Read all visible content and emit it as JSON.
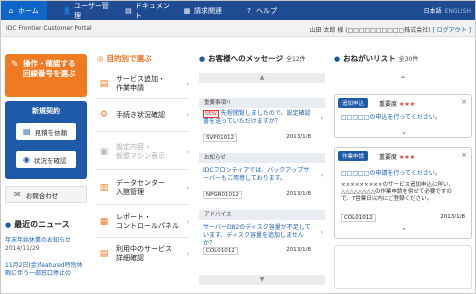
{
  "nav": {
    "tabs": [
      "ホーム",
      "ユーザー管理",
      "ドキュメント",
      "請求関連",
      "ヘルプ"
    ],
    "lang_ja": "日本語",
    "lang_en": "ENGLISH"
  },
  "sub": {
    "portal": "IDC Frontier Customer Portal",
    "user": "山田 太郎 様 (□□□□□□□□□□株式会社)",
    "logout": "[ ログアウト ]"
  },
  "left": {
    "reg_line1": "操作・確認する",
    "reg_line2": "回線番号を選ぶ",
    "new_contract": "新規契約",
    "quote": "見積を依頼",
    "status": "状況を確認",
    "contact": "お問合わせ",
    "news_title": "最近のニュース",
    "news": [
      {
        "title": "年末年始休業のお知らせ",
        "date": "2014/11/29"
      },
      {
        "title": "11月2日(金)featured特別休",
        "title2": "暇に伴う一部窓口停止の"
      }
    ]
  },
  "purpose": {
    "title": "目的別で選ぶ",
    "items": [
      {
        "l1": "サービス追加・",
        "l2": "作業申請"
      },
      {
        "l1": "手続き状況確認"
      },
      {
        "l1": "設定内容・",
        "l2": "仮想マシン表示"
      },
      {
        "l1": "データセンター",
        "l2": "入館管理"
      },
      {
        "l1": "レポート・",
        "l2": "コントロールパネル"
      },
      {
        "l1": "利用中のサービス",
        "l2": "詳細確認"
      }
    ]
  },
  "messages": {
    "title": "お客様へのメッセージ",
    "count": "全12件",
    "items": [
      {
        "cat": "重要事項!!",
        "badge": "NEW",
        "body": "先程閲覧しましたので、設定確認書を送っていただけますか？",
        "id": "SVP01012",
        "date": "2013/1/8"
      },
      {
        "cat": "お知らせ",
        "body": "IDCフロンティアでは、バックアップサーバーもご用意しております。",
        "id": "NPGR01012",
        "date": "2013/1/8"
      },
      {
        "cat": "アドバイス",
        "body": "サーバーD82のディスク容量が不足しています。ディスク容量を追加しませんか？",
        "id": "COL01012",
        "date": "2013/1/8"
      }
    ]
  },
  "fav": {
    "title": "おねがいリスト",
    "count": "全30件",
    "importance_label": "重要度",
    "items": [
      {
        "tag": "追加申込",
        "stars": "★★★",
        "title": "□□□□□の申込を行ってください。"
      },
      {
        "tag": "作業申請",
        "stars": "★★★",
        "title": "□□□□□の申請を行ってください。",
        "body": "×××××××××のサービス追加申込に伴い、△△△△△△△△の作業申請を併せて必要ですので、7営業日以内にご登録ください。",
        "id": "COL01012",
        "date": "2013/1/8"
      }
    ]
  },
  "colors": {
    "nav": "#1f4b93",
    "nav_active": "#0f66c9",
    "accent_orange": "#f07a21",
    "primary_blue": "#1e5aa8",
    "link": "#1a5fb4",
    "star": "#e33333"
  }
}
